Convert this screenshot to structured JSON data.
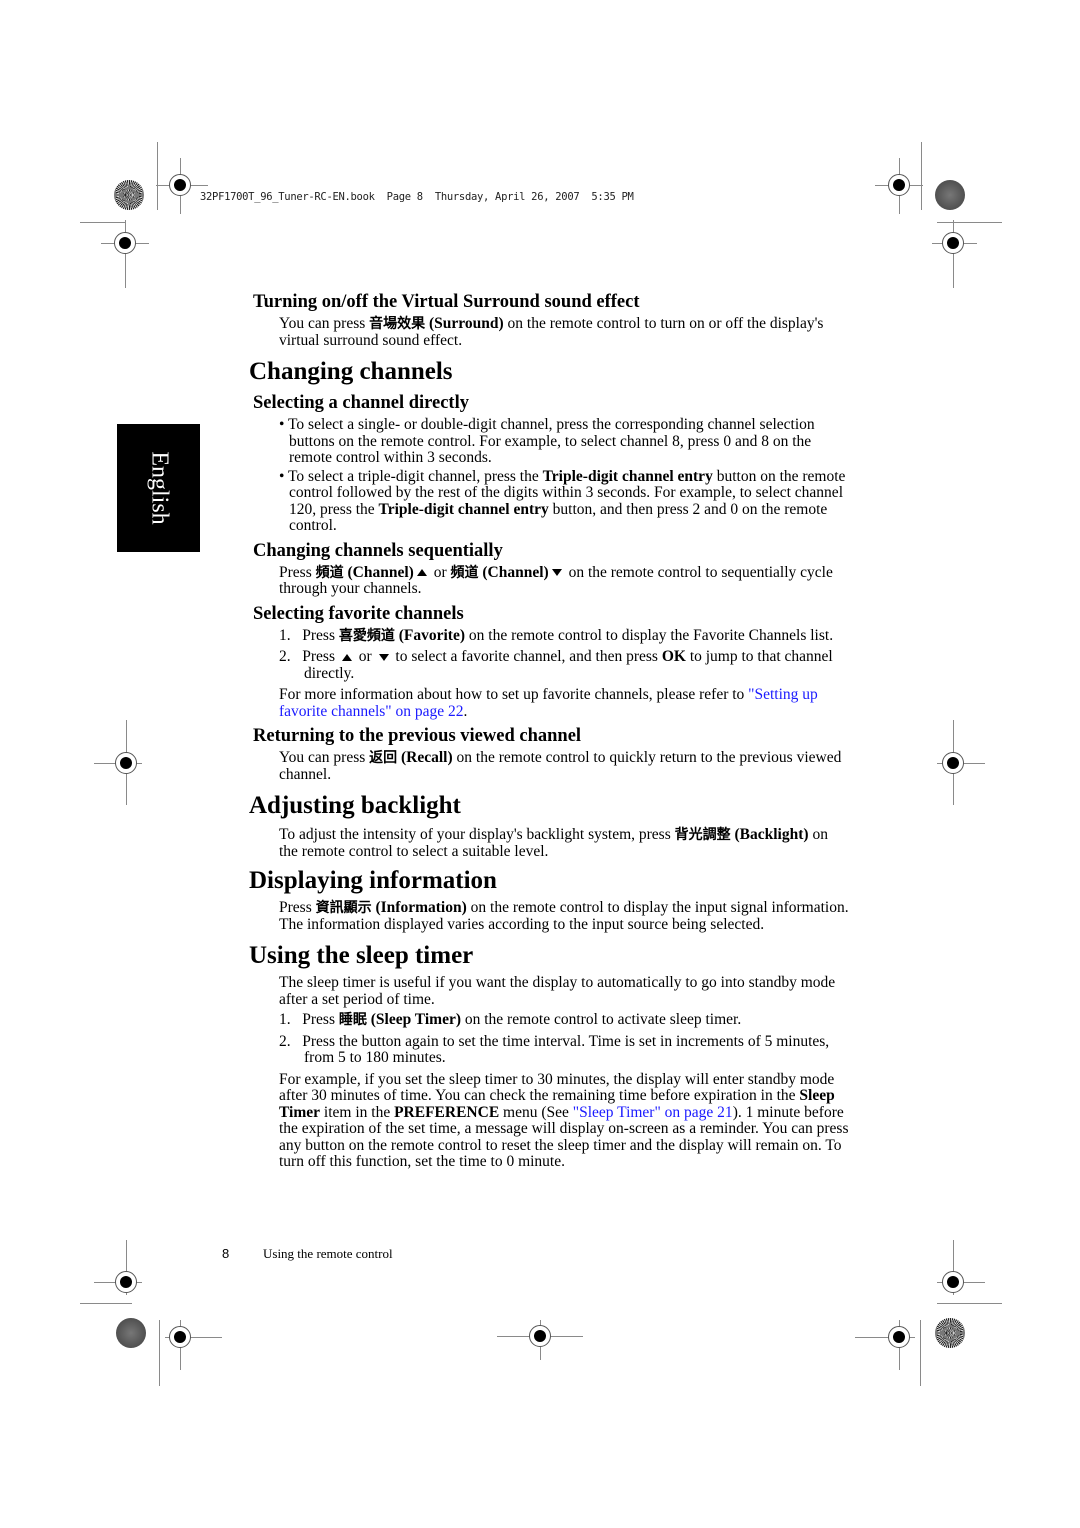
{
  "header": {
    "print_slug": "32PF1700T_96_Tuner-RC-EN.book  Page 8  Thursday, April 26, 2007  5:35 PM"
  },
  "side_tab": {
    "label": "English"
  },
  "sections": {
    "surround": {
      "heading": "Turning on/off the Virtual Surround sound effect",
      "p1_pre": "You can press ",
      "p1_cjk": "音場效果",
      "p1_bold": " (Surround)",
      "p1_post": " on the remote control to turn on or off the display's virtual surround sound effect."
    },
    "changing_channels": {
      "heading": "Changing channels",
      "directly": {
        "heading": "Selecting a channel directly",
        "bullet1": "To select a single- or double-digit channel, press the corresponding channel selection buttons on the remote control. For example, to select channel 8, press 0 and 8 on the remote control within 3 seconds.",
        "bullet2_a": "To select a triple-digit channel, press the ",
        "bullet2_b": "Triple-digit channel entry",
        "bullet2_c": " button on the remote control followed by the rest of the digits within 3 seconds. For example, to select channel 120, press the ",
        "bullet2_d": "Triple-digit channel entry",
        "bullet2_e": " button, and then press 2 and 0 on the remote control."
      },
      "sequentially": {
        "heading": "Changing channels sequentially",
        "a": "Press ",
        "cjk1": "頻道",
        "b": " (Channel)",
        "c": " or ",
        "cjk2": "頻道",
        "d": " (Channel)",
        "e": " on the remote control to sequentially cycle through your channels."
      },
      "favorite": {
        "heading": "Selecting favorite channels",
        "step1_num": "1.",
        "step1_a": "Press ",
        "step1_cjk": "喜愛頻道",
        "step1_b": " (Favorite)",
        "step1_c": " on the remote control to display the Favorite Channels list.",
        "step2_num": "2.",
        "step2_a": "Press ",
        "step2_b": " or ",
        "step2_c": " to select a favorite channel, and then press ",
        "step2_ok": "OK",
        "step2_d": " to jump to that channel directly.",
        "more_a": "For more information about how to set up favorite channels, please refer to ",
        "more_link": "\"Setting up favorite channels\" on page 22",
        "more_b": "."
      },
      "recall": {
        "heading": "Returning to the previous viewed channel",
        "a": "You can press ",
        "cjk": "返回",
        "b": " (Recall)",
        "c": " on the remote control to quickly return to the previous viewed channel."
      }
    },
    "backlight": {
      "heading": "Adjusting backlight",
      "a": "To adjust the intensity of your display's backlight system, press ",
      "cjk": "背光調整",
      "b": " (Backlight)",
      "c": "  on the remote control to select a suitable level."
    },
    "information": {
      "heading": "Displaying information",
      "a": "Press ",
      "cjk": "資訊顯示",
      "b": " (Information)",
      "c": " on the remote control to display the input signal information. The information displayed varies according to the input source being selected."
    },
    "sleep": {
      "heading": "Using the sleep timer",
      "intro": "The sleep timer is useful if you want the display to automatically to go into standby mode after a set period of time.",
      "step1_num": "1.",
      "step1_a": "Press ",
      "step1_cjk": "睡眠",
      "step1_b": " (Sleep Timer)",
      "step1_c": " on the remote control to activate sleep timer.",
      "step2_num": "2.",
      "step2": "Press the button again to set the time interval. Time is set in increments of 5 minutes, from 5 to 180 minutes.",
      "ex_a": "For example, if you set the sleep timer to 30 minutes, the display will enter standby mode after 30 minutes of time. You can check the remaining time before expiration in the ",
      "ex_b": "Sleep Timer",
      "ex_c": " item in the ",
      "ex_d": "PREFERENCE",
      "ex_e": " menu (See ",
      "ex_link": "\"Sleep Timer\" on page 21",
      "ex_f": "). 1 minute before the expiration of the set time, a message will display on-screen as a reminder. You can press any button on the remote control to reset the sleep timer and the display will remain on. To turn off this function, set the time to 0 minute."
    }
  },
  "footer": {
    "page_number": "8",
    "chapter_title": "Using the remote control"
  }
}
